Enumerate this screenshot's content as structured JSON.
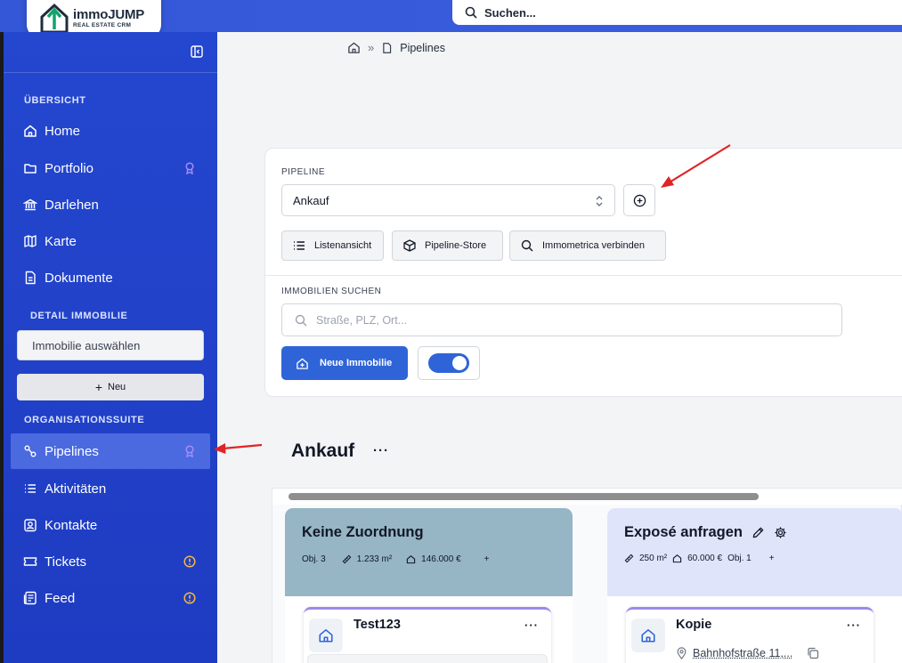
{
  "logo": {
    "name": "immoJUMP",
    "subtitle": "REAL ESTATE CRM"
  },
  "search": {
    "placeholder": "Suchen..."
  },
  "sidebar": {
    "sections": {
      "overview": "ÜBERSICHT",
      "detail": "DETAIL IMMOBILIE",
      "org": "ORGANISATIONSSUITE"
    },
    "items": [
      {
        "label": "Home",
        "icon": "home-icon"
      },
      {
        "label": "Portfolio",
        "icon": "folder-icon",
        "badge": "award-icon"
      },
      {
        "label": "Darlehen",
        "icon": "bank-icon"
      },
      {
        "label": "Karte",
        "icon": "map-icon"
      },
      {
        "label": "Dokumente",
        "icon": "document-icon"
      },
      {
        "label": "Pipelines",
        "icon": "workflow-icon",
        "badge": "award-icon",
        "active": true
      },
      {
        "label": "Aktivitäten",
        "icon": "list-icon"
      },
      {
        "label": "Kontakte",
        "icon": "contact-icon"
      },
      {
        "label": "Tickets",
        "icon": "ticket-icon",
        "badge": "alert-icon"
      },
      {
        "label": "Feed",
        "icon": "feed-icon",
        "badge": "alert-icon"
      }
    ],
    "property_select_placeholder": "Immobilie auswählen",
    "new_button": "Neu"
  },
  "breadcrumb": {
    "current": "Pipelines"
  },
  "pipeline": {
    "label": "PIPELINE",
    "selected": "Ankauf",
    "buttons": [
      "Listenansicht",
      "Pipeline-Store",
      "Immometrica verbinden"
    ],
    "search_label": "IMMOBILIEN SUCHEN",
    "search_placeholder": "Straße, PLZ, Ort...",
    "new_property": "Neue Immobilie",
    "toggle_on": true
  },
  "board": {
    "title": "Ankauf",
    "more": "···",
    "columns": [
      {
        "title": "Keine Zuordnung",
        "obj": "Obj. 3",
        "area": "1.233 m²",
        "value": "146.000 €",
        "plus": "+",
        "card": {
          "title": "Test123",
          "more": "···"
        }
      },
      {
        "title": "Exposé anfragen",
        "obj": "Obj. 1",
        "area": "250 m²",
        "value": "60.000 €",
        "plus": "+",
        "card": {
          "title": "Kopie",
          "more": "···",
          "address": "Bahnhofstraße 11,..."
        }
      }
    ]
  },
  "colors": {
    "sidebar": "#2447cf",
    "active": "#4b6ae0",
    "primary": "#2f64d8",
    "badge_purple": "#a78bfa",
    "badge_yellow": "#f5b83d",
    "arrow": "#e02424"
  }
}
